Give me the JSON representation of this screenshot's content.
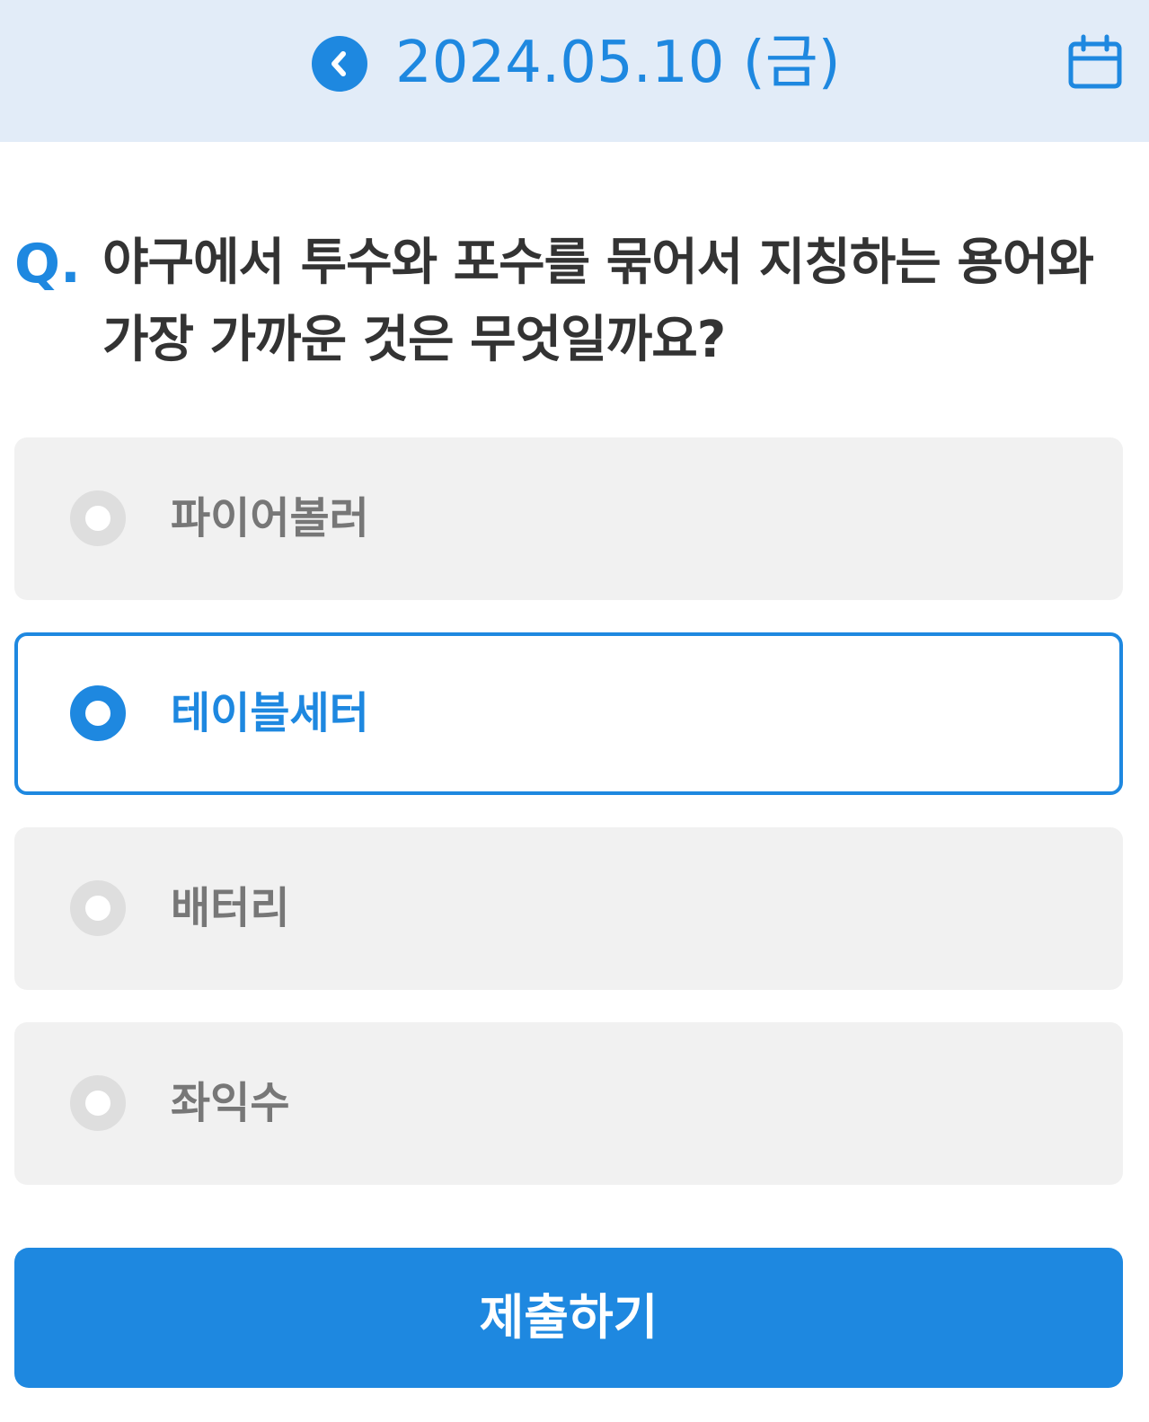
{
  "header": {
    "prev_icon": "chevron-left-icon",
    "date": "2024.05.10 (금)",
    "calendar_icon": "calendar-icon"
  },
  "question": {
    "prefix": "Q.",
    "text": "야구에서 투수와 포수를 묶어서 지칭하는 용어와 가장 가까운 것은 무엇일까요?"
  },
  "options": [
    {
      "label": "파이어볼러",
      "selected": false
    },
    {
      "label": "테이블세터",
      "selected": true
    },
    {
      "label": "배터리",
      "selected": false
    },
    {
      "label": "좌익수",
      "selected": false
    }
  ],
  "submit_label": "제출하기",
  "colors": {
    "accent": "#1e88e0",
    "header_bg": "#e2ecf8",
    "option_bg": "#f1f1f1",
    "text_dark": "#333333",
    "text_muted": "#777777"
  }
}
